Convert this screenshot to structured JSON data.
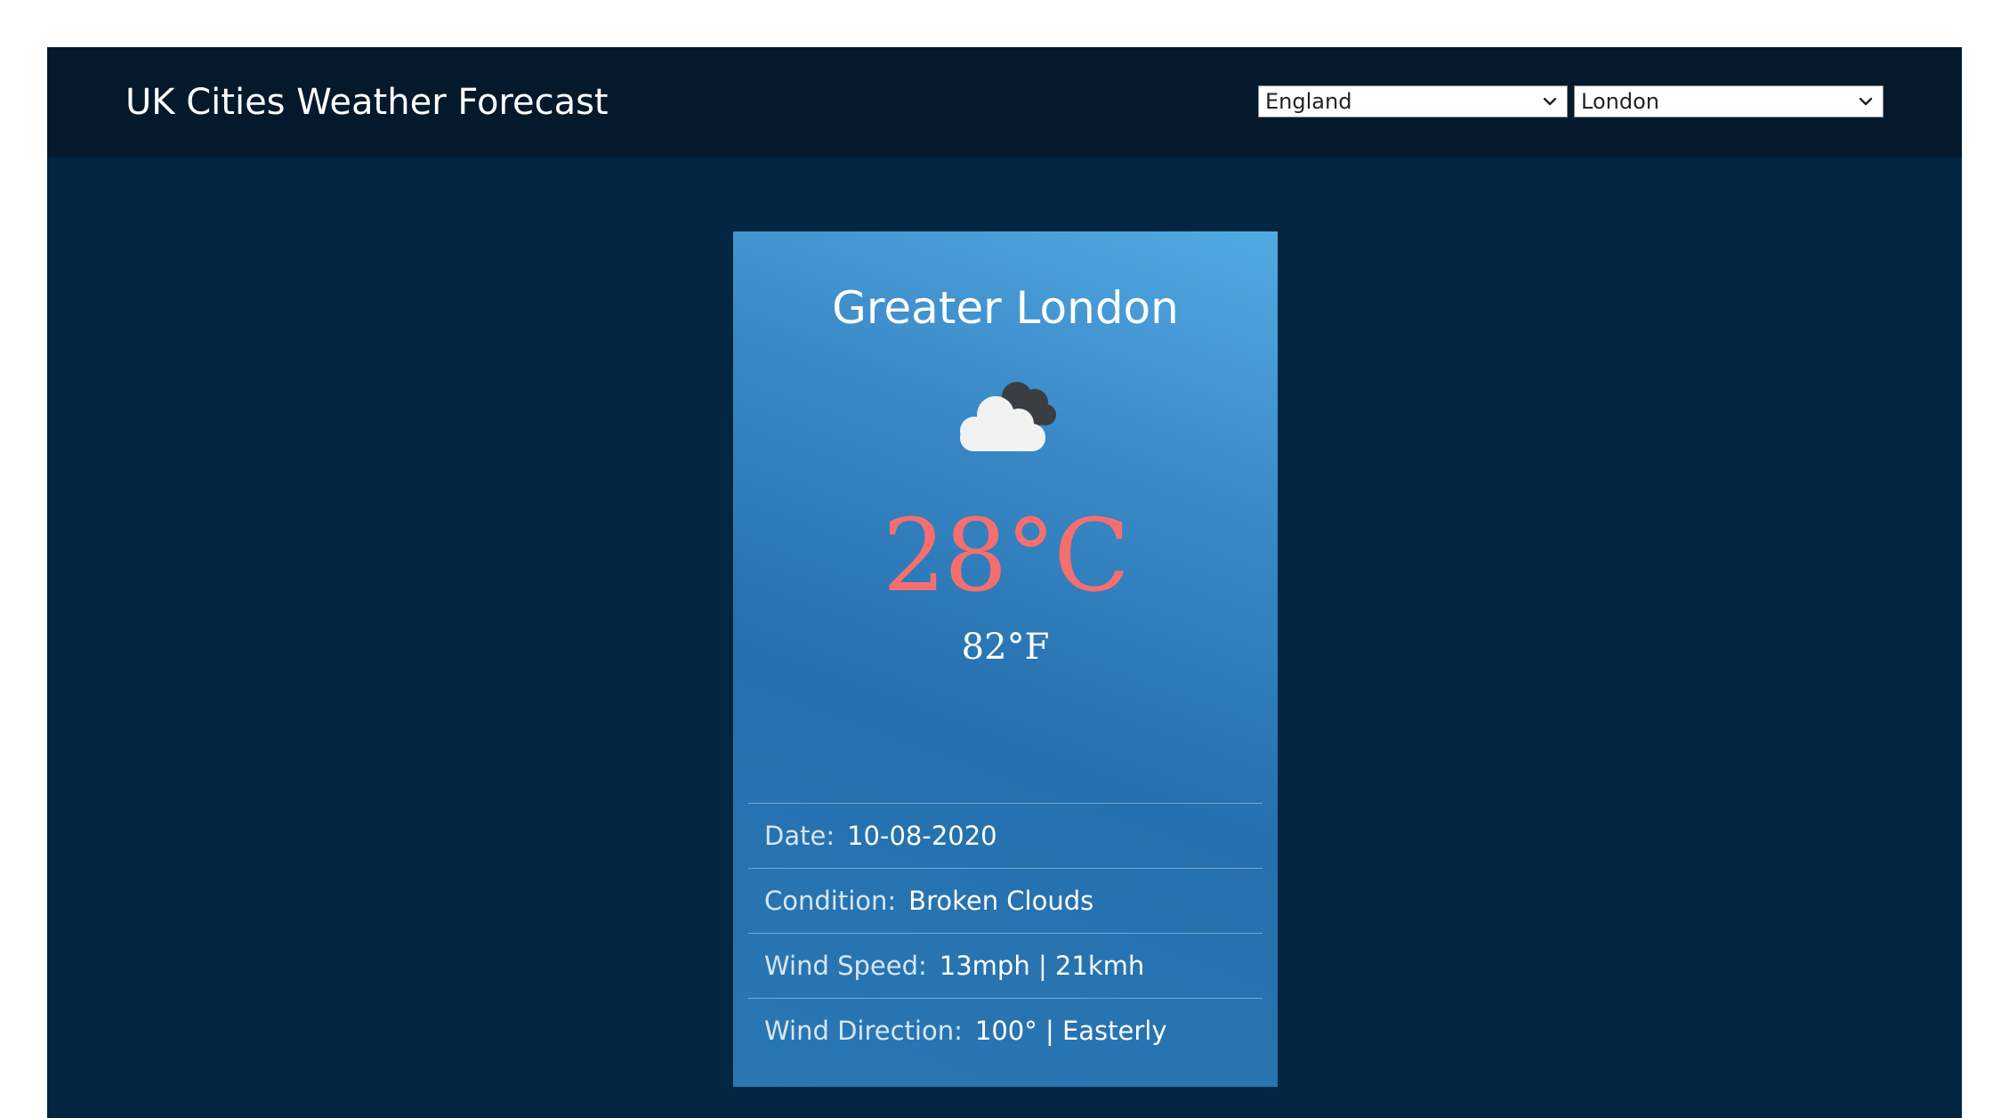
{
  "header": {
    "title": "UK Cities Weather Forecast",
    "region_select": {
      "value": "England"
    },
    "city_select": {
      "value": "London"
    }
  },
  "card": {
    "location": "Greater London",
    "icon": "broken-clouds-icon",
    "temp_c": "28°C",
    "temp_f": "82°F",
    "details": [
      {
        "label": "Date:",
        "value": "10-08-2020"
      },
      {
        "label": "Condition:",
        "value": "Broken Clouds"
      },
      {
        "label": "Wind Speed:",
        "value": "13mph | 21kmh"
      },
      {
        "label": "Wind Direction:",
        "value": "100° | Easterly"
      }
    ]
  },
  "colors": {
    "page_background": "#032742",
    "header_background": "#041a2c",
    "temperature_accent": "#f46f6f"
  }
}
